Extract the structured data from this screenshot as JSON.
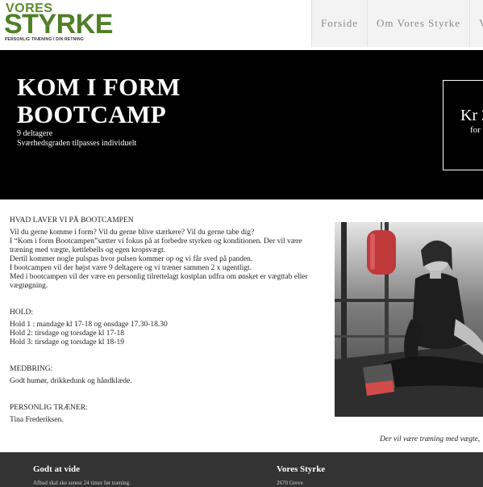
{
  "logo": {
    "top": "VORES",
    "main": "STYRKE",
    "tagline": "PERSONLIG TRÆNING I DIN RETNING"
  },
  "nav": {
    "items": [
      "Forside",
      "Om Vores Styrke",
      "V"
    ]
  },
  "hero": {
    "title_line1": "KOM I FORM",
    "title_line2": "BOOTCAMP",
    "sub1": "9 deltagere",
    "sub2": "Sværhedsgraden tilpasses individuelt",
    "price_main": "Kr 2",
    "price_sub": "for"
  },
  "content": {
    "heading": "HVAD LAVER VI PÅ BOOTCAMPEN",
    "intro": [
      "Vil du gerne komme i form? Vil du gerne blive stærkere? Vil du gerne tabe dig?",
      "I “Kom i form Bootcampen”sætter vi fokus på at forbedre styrken og konditionen. Der vil være træning med vægte, kettlebells og egen kropsvægt.",
      "Dertil kommer nogle pulspas hvor pulsen kommer op og vi får sved på panden.",
      "I bootcampen vil der højst være 9 deltagere og vi træner sammen 2 x ugentligt.",
      "Med i bootcampen vil der være en personlig tilrettelagt kostplan udfra om ønsket er vægttab eller vægtøgning."
    ],
    "hold_heading": "HOLD:",
    "hold": [
      "Hold 1 : mandage kl 17-18 og onsdage 17.30-18.30",
      "Hold 2: tirsdage og torsdage kl 17-18",
      "Hold 3: tirsdage og torsdage kl 18-19"
    ],
    "medbring_heading": "MEDBRING:",
    "medbring": "Godt humør, drikkedunk og håndklæde.",
    "trainer_heading": "PERSONLIG TRÆNER:",
    "trainer": "Tina Frederiksen."
  },
  "photo": {
    "caption": "Der vil være træning med vægte,"
  },
  "footer": {
    "col1_heading": "Godt at vide",
    "col1_text": "Afbud skal ske senest 24 timer før træning.",
    "col2_heading": "Vores Styrke",
    "col2_text": "2670 Greve"
  }
}
